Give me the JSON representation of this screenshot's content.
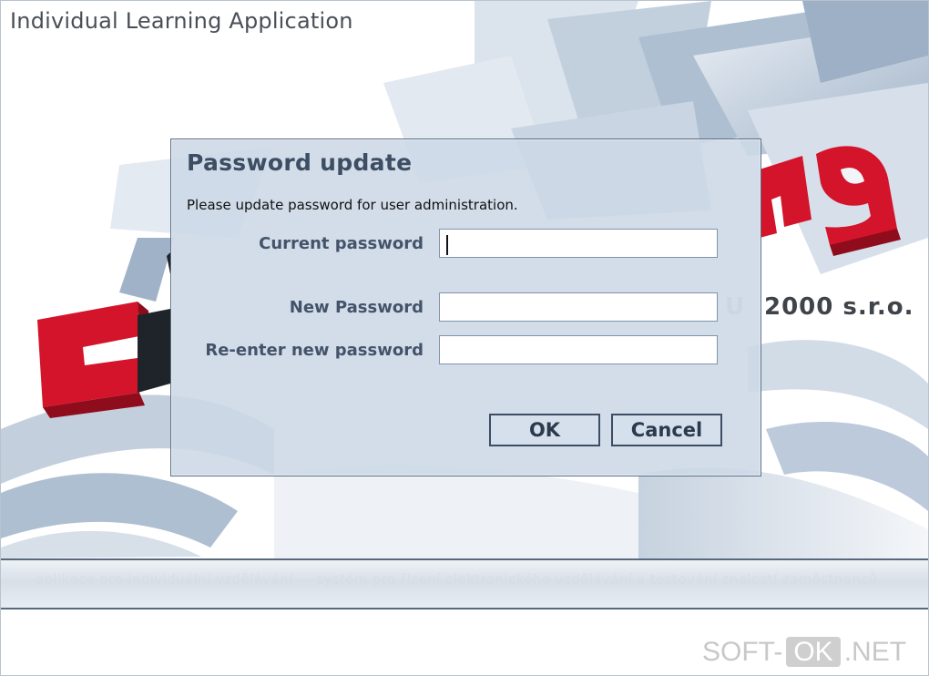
{
  "app": {
    "title": "Individual Learning Application",
    "company": "2000 s.r.o.",
    "company_fragment": "U",
    "footer_text": "aplikace pro individuální vzdělávání   —   systém pro řízení elektronického vzdělávání a testování znalostí zaměstnanců",
    "logo_text": "Edu-learning"
  },
  "dialog": {
    "title": "Password update",
    "message": "Please update password for user administration.",
    "fields": {
      "current": {
        "label": "Current password",
        "value": ""
      },
      "new": {
        "label": "New Password",
        "value": ""
      },
      "reenter": {
        "label": "Re-enter new password",
        "value": ""
      }
    },
    "buttons": {
      "ok": "OK",
      "cancel": "Cancel"
    }
  },
  "watermark": {
    "prefix": "SOFT-",
    "ok": "OK",
    "suffix": ".NET"
  },
  "colors": {
    "accent": "#3d4d63",
    "dialog_bg": "#ccd8e6",
    "logo_red": "#d3142a",
    "logo_dark": "#1f232a"
  }
}
